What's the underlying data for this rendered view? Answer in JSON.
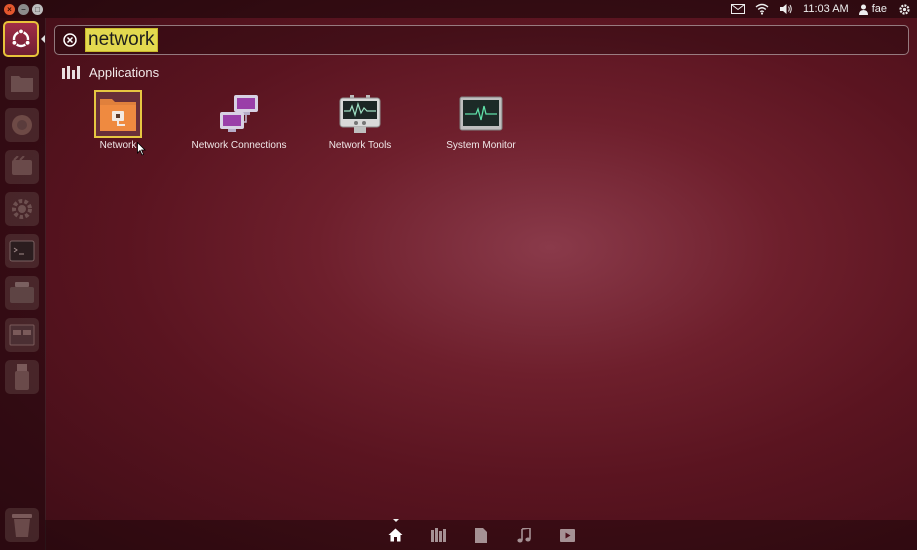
{
  "top_panel": {
    "time": "11:03 AM",
    "user": "fae"
  },
  "search": {
    "query": "network"
  },
  "results": {
    "category_label": "Applications",
    "apps": [
      {
        "label": "Network",
        "icon": "network-folder-icon"
      },
      {
        "label": "Network Connections",
        "icon": "network-connections-icon"
      },
      {
        "label": "Network Tools",
        "icon": "network-tools-icon"
      },
      {
        "label": "System Monitor",
        "icon": "system-monitor-icon"
      }
    ]
  },
  "lenses": [
    {
      "name": "home",
      "icon": "home-icon",
      "active": true
    },
    {
      "name": "applications",
      "icon": "applications-icon",
      "active": false
    },
    {
      "name": "files",
      "icon": "files-icon",
      "active": false
    },
    {
      "name": "music",
      "icon": "music-icon",
      "active": false
    },
    {
      "name": "video",
      "icon": "video-icon",
      "active": false
    }
  ],
  "colors": {
    "selection_highlight": "#e3d94f",
    "focus_border": "#e6c641"
  }
}
